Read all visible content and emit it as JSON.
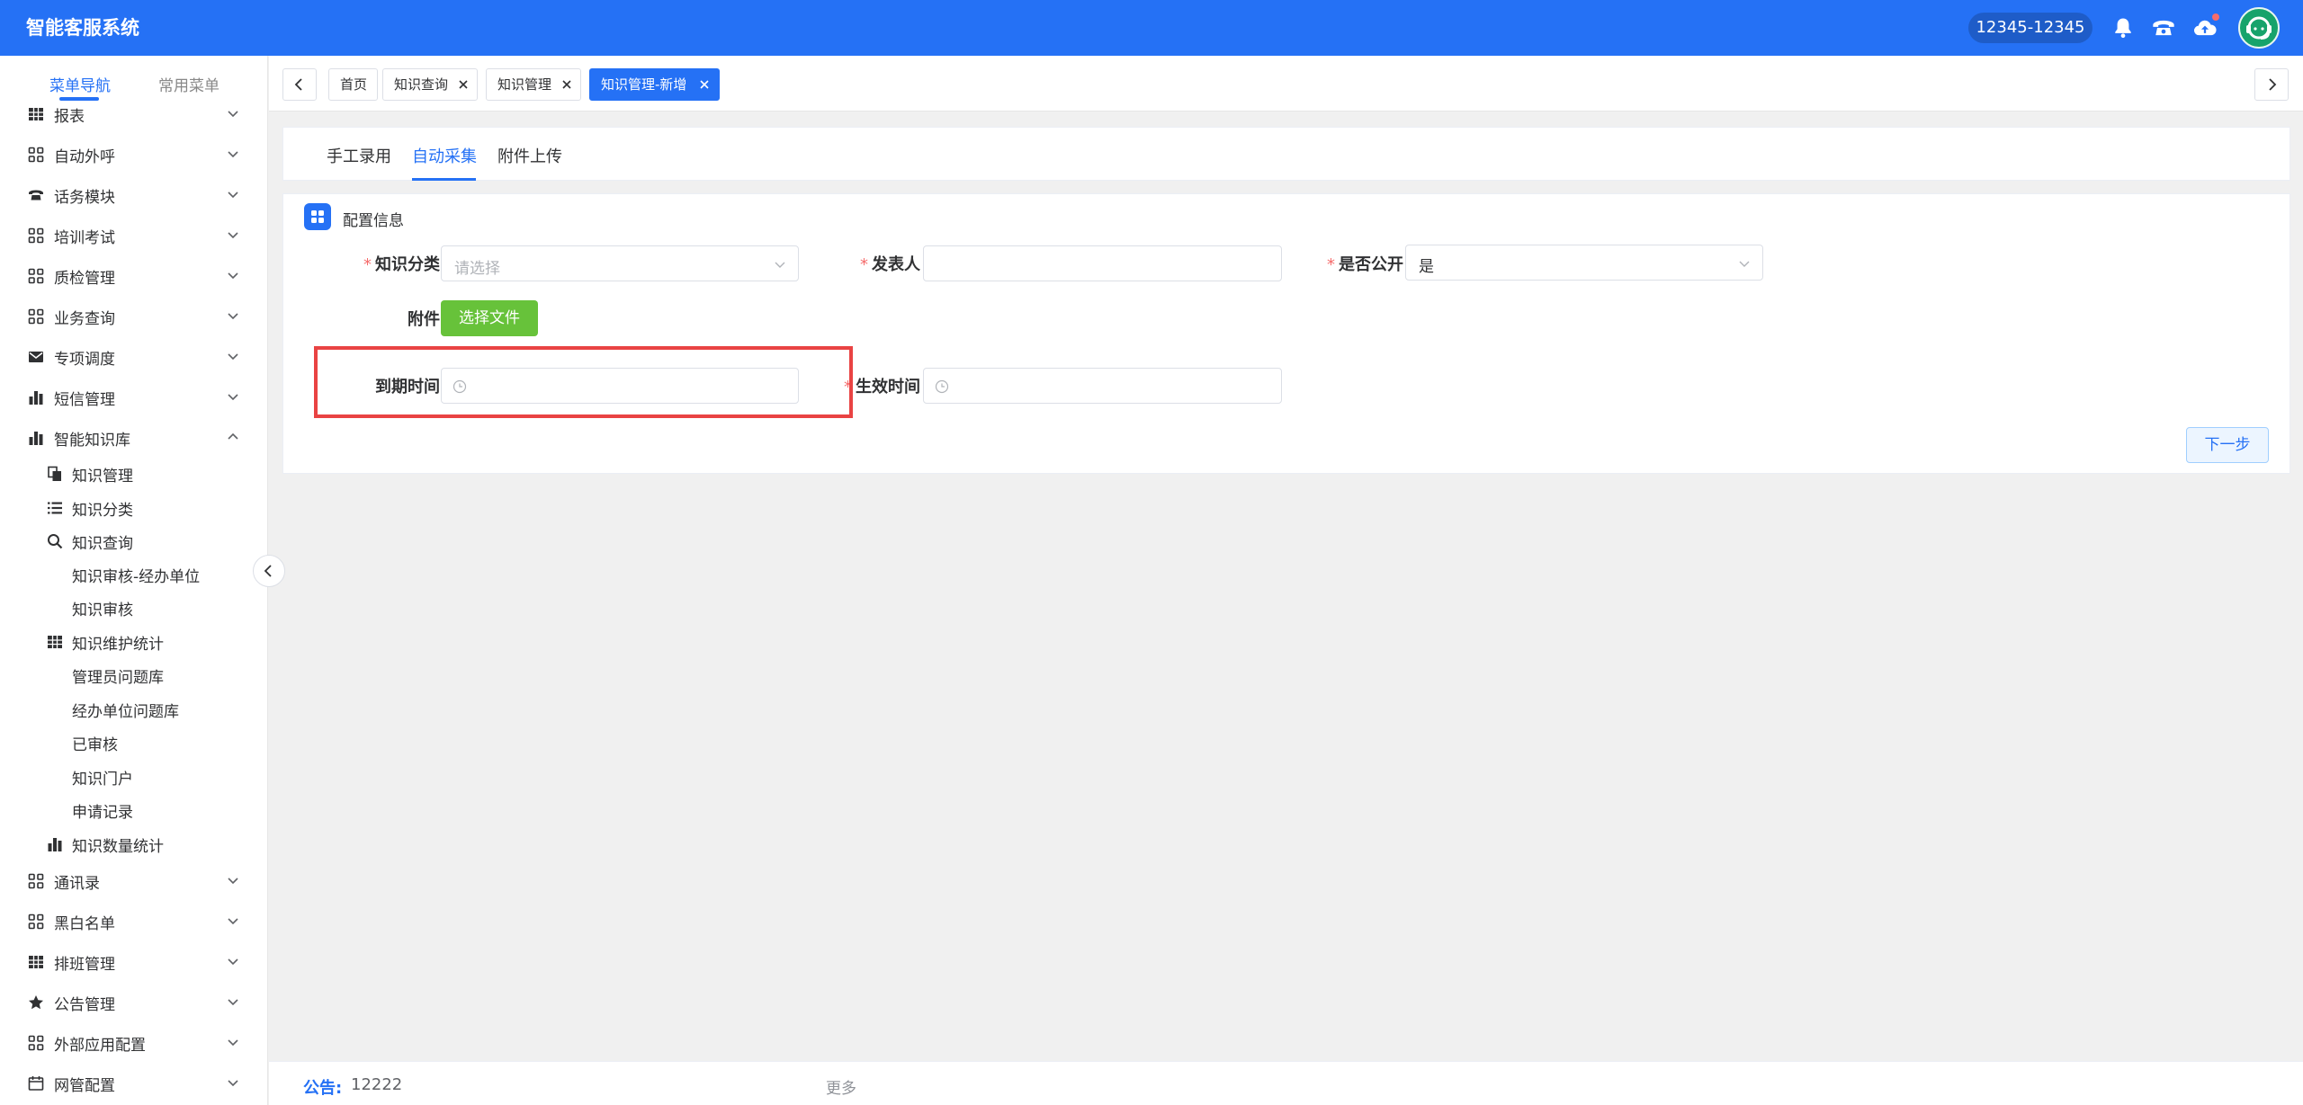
{
  "app": {
    "title": "智能客服系统",
    "hotline": "12345-12345"
  },
  "colors": {
    "primary": "#2571f5",
    "success": "#67c23a",
    "required": "#f56c6c",
    "highlight": "#e94343"
  },
  "header_icons": [
    "bell-icon",
    "telephone-icon",
    "cloud-upload-icon",
    "agent-avatar-icon"
  ],
  "sidebar": {
    "tabs": [
      {
        "label": "菜单导航",
        "active": true
      },
      {
        "label": "常用菜单",
        "active": false
      }
    ],
    "items": [
      {
        "label": "报表",
        "icon": "table-icon"
      },
      {
        "label": "自动外呼",
        "icon": "grid-icon"
      },
      {
        "label": "话务模块",
        "icon": "telephone-icon"
      },
      {
        "label": "培训考试",
        "icon": "grid-icon"
      },
      {
        "label": "质检管理",
        "icon": "grid-icon"
      },
      {
        "label": "业务查询",
        "icon": "grid-icon"
      },
      {
        "label": "专项调度",
        "icon": "mail-icon"
      },
      {
        "label": "短信管理",
        "icon": "bar-chart-icon"
      },
      {
        "label": "智能知识库",
        "icon": "bar-chart-icon",
        "expanded": true
      },
      {
        "label": "通讯录",
        "icon": "grid-icon"
      },
      {
        "label": "黑白名单",
        "icon": "grid-icon"
      },
      {
        "label": "排班管理",
        "icon": "table-icon"
      },
      {
        "label": "公告管理",
        "icon": "star-icon"
      },
      {
        "label": "外部应用配置",
        "icon": "grid-icon"
      },
      {
        "label": "网管配置",
        "icon": "calendar-icon"
      }
    ],
    "sub_items": [
      {
        "label": "知识管理",
        "icon": "document-copy-icon"
      },
      {
        "label": "知识分类",
        "icon": "list-icon"
      },
      {
        "label": "知识查询",
        "icon": "search-icon"
      },
      {
        "label": "知识审核-经办单位",
        "icon": ""
      },
      {
        "label": "知识审核",
        "icon": ""
      },
      {
        "label": "知识维护统计",
        "icon": "table-icon"
      },
      {
        "label": "管理员问题库",
        "icon": ""
      },
      {
        "label": "经办单位问题库",
        "icon": ""
      },
      {
        "label": "已审核",
        "icon": ""
      },
      {
        "label": "知识门户",
        "icon": ""
      },
      {
        "label": "申请记录",
        "icon": ""
      },
      {
        "label": "知识数量统计",
        "icon": "bar-chart-icon"
      }
    ]
  },
  "page_tabs": [
    {
      "label": "首页",
      "closable": false,
      "active": false
    },
    {
      "label": "知识查询",
      "closable": true,
      "active": false
    },
    {
      "label": "知识管理",
      "closable": true,
      "active": false
    },
    {
      "label": "知识管理-新增",
      "closable": true,
      "active": true
    }
  ],
  "content_tabs": [
    {
      "label": "手工录用",
      "active": false
    },
    {
      "label": "自动采集",
      "active": true
    },
    {
      "label": "附件上传",
      "active": false
    }
  ],
  "form": {
    "section_title": "配置信息",
    "category": {
      "label": "知识分类",
      "required": "*",
      "placeholder": "请选择"
    },
    "publisher": {
      "label": "发表人",
      "required": "*",
      "value": ""
    },
    "is_public": {
      "label": "是否公开",
      "required": "*",
      "value": "是"
    },
    "attachment": {
      "label": "附件",
      "button": "选择文件"
    },
    "expire_time": {
      "label": "到期时间",
      "value": ""
    },
    "effective_time": {
      "label": "生效时间",
      "required": "*",
      "value": ""
    },
    "next_button": "下一步"
  },
  "notice": {
    "label": "公告:",
    "text": "12222",
    "more": "更多"
  }
}
